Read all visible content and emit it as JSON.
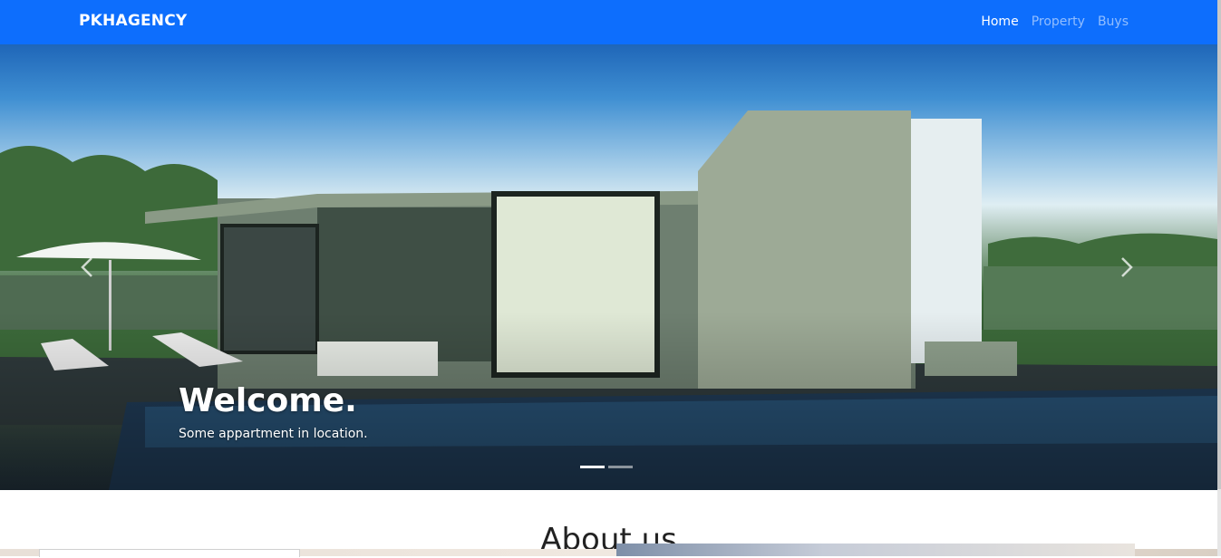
{
  "navbar": {
    "brand": "PKHAGENCY",
    "links": [
      {
        "label": "Home",
        "active": true
      },
      {
        "label": "Property",
        "active": false
      },
      {
        "label": "Buys",
        "active": false
      }
    ],
    "background_color": "#0d6efd"
  },
  "hero": {
    "title": "Welcome.",
    "subtitle": "Some appartment in location.",
    "image_description": "modern-house-with-pool",
    "slide_count": 2,
    "active_slide": 1,
    "prev_icon": "chevron-left-icon",
    "next_icon": "chevron-right-icon"
  },
  "about": {
    "title": "About us"
  }
}
